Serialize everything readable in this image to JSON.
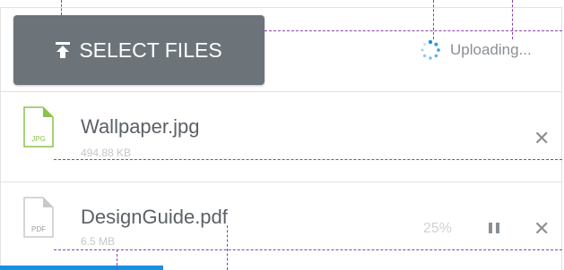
{
  "uploader": {
    "select_label": "SELECT FILES",
    "status_text": "Uploading...",
    "files": [
      {
        "name": "Wallpaper.jpg",
        "size": "494.88 KB",
        "type": "JPG",
        "icon_color": "#8bc34a"
      },
      {
        "name": "DesignGuide.pdf",
        "size": "6.5 MB",
        "type": "PDF",
        "progress_text": "25%",
        "progress_fraction": 0.25,
        "icon_color": "#c9c9c9"
      }
    ],
    "colors": {
      "button": "#6d7479",
      "progress": "#1a8fe0",
      "spinner": "#1a8fe0",
      "text": "#5c6166",
      "muted": "#8a8f94"
    },
    "icons": [
      "upload-arrow-icon",
      "spinner-icon",
      "jpg-file-icon",
      "pdf-file-icon",
      "close-icon",
      "pause-icon"
    ]
  }
}
